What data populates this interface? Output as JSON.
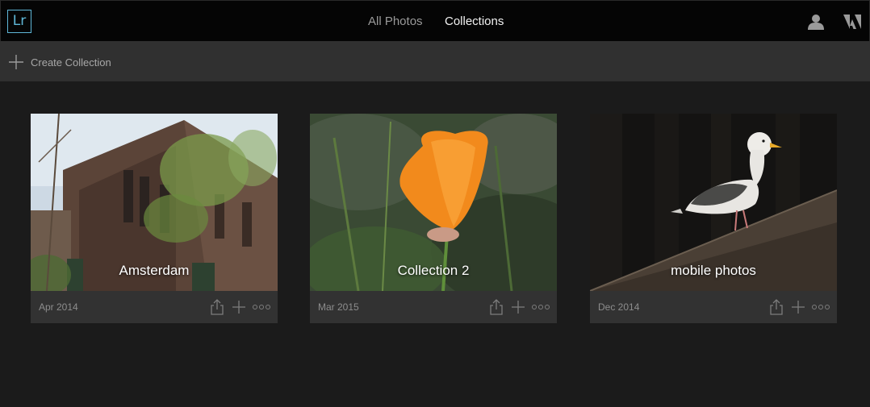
{
  "app": {
    "logo_text": "Lr"
  },
  "nav": {
    "tabs": [
      {
        "label": "All Photos",
        "active": false
      },
      {
        "label": "Collections",
        "active": true
      }
    ]
  },
  "header_icons": [
    "user-icon",
    "adobe-icon"
  ],
  "toolbar": {
    "create_label": "Create Collection"
  },
  "colors": {
    "accent": "#5fb7d8",
    "background": "#1b1b1b",
    "toolbar": "#303030",
    "topbar": "#050505"
  },
  "collections": [
    {
      "title": "Amsterdam",
      "date": "Apr 2014"
    },
    {
      "title": "Collection 2",
      "date": "Mar 2015"
    },
    {
      "title": "mobile photos",
      "date": "Dec 2014"
    }
  ]
}
